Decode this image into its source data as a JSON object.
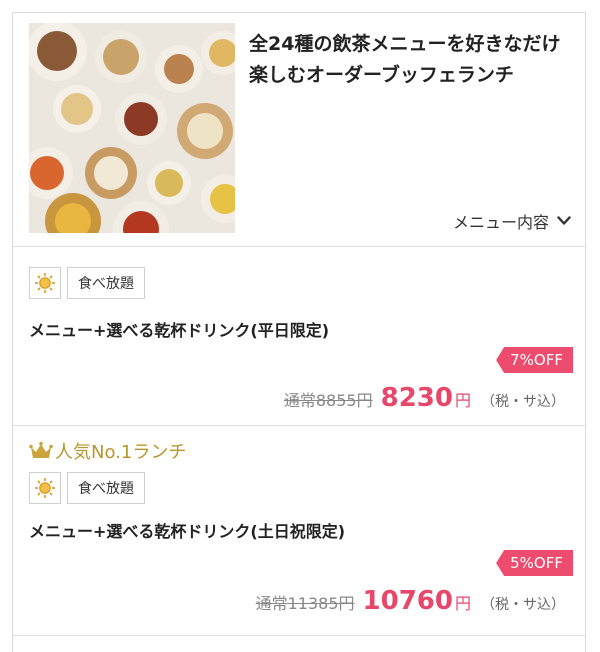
{
  "header": {
    "title_line1": "全24種の飲茶メニューを好きなだけ",
    "title_line2": "楽しむオーダーブッフェランチ",
    "menu_toggle_label": "メニュー内容"
  },
  "plans": [
    {
      "tag_label": "食べ放題",
      "name": "メニュー+選べる乾杯ドリンク(平日限定)",
      "discount": "7%OFF",
      "regular_label": "通常",
      "regular_price": "8855円",
      "price": "8230",
      "yen": "円",
      "tax": "（税・サ込）"
    },
    {
      "rank_label": "人気No.1ランチ",
      "tag_label": "食べ放題",
      "name": "メニュー+選べる乾杯ドリンク(土日祝限定)",
      "discount": "5%OFF",
      "regular_label": "通常",
      "regular_price": "11385円",
      "price": "10760",
      "yen": "円",
      "tax": "（税・サ込）"
    }
  ],
  "colors": {
    "accent": "#e8476c",
    "gold": "#b8962f",
    "border": "#d9d9d9"
  }
}
